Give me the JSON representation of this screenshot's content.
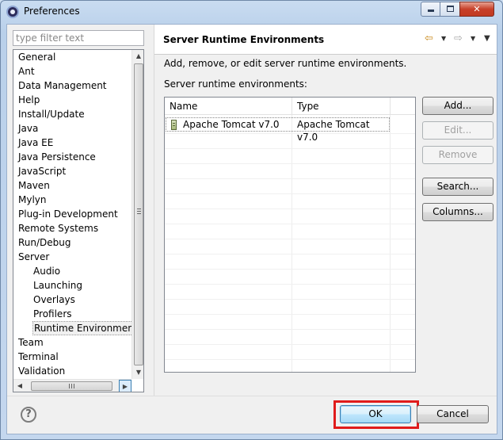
{
  "window": {
    "title": "Preferences",
    "close_glyph": "✕"
  },
  "sidebar": {
    "filter_placeholder": "type filter text",
    "items": [
      {
        "label": "General"
      },
      {
        "label": "Ant"
      },
      {
        "label": "Data Management"
      },
      {
        "label": "Help"
      },
      {
        "label": "Install/Update"
      },
      {
        "label": "Java"
      },
      {
        "label": "Java EE"
      },
      {
        "label": "Java Persistence"
      },
      {
        "label": "JavaScript"
      },
      {
        "label": "Maven"
      },
      {
        "label": "Mylyn"
      },
      {
        "label": "Plug-in Development"
      },
      {
        "label": "Remote Systems"
      },
      {
        "label": "Run/Debug"
      },
      {
        "label": "Server"
      },
      {
        "label": "Audio"
      },
      {
        "label": "Launching"
      },
      {
        "label": "Overlays"
      },
      {
        "label": "Profilers"
      },
      {
        "label": "Runtime Environments"
      },
      {
        "label": "Team"
      },
      {
        "label": "Terminal"
      },
      {
        "label": "Validation"
      }
    ],
    "hscroll_grip": "III"
  },
  "page": {
    "title": "Server Runtime Environments",
    "description": "Add, remove, or edit server runtime environments.",
    "list_label": "Server runtime environments:",
    "columns": [
      "Name",
      "Type"
    ],
    "rows": [
      {
        "name": "Apache Tomcat v7.0",
        "type": "Apache Tomcat v7.0"
      }
    ]
  },
  "buttons": {
    "add": "Add...",
    "edit": "Edit...",
    "remove": "Remove",
    "search": "Search...",
    "columns": "Columns...",
    "ok": "OK",
    "cancel": "Cancel",
    "help": "?"
  }
}
